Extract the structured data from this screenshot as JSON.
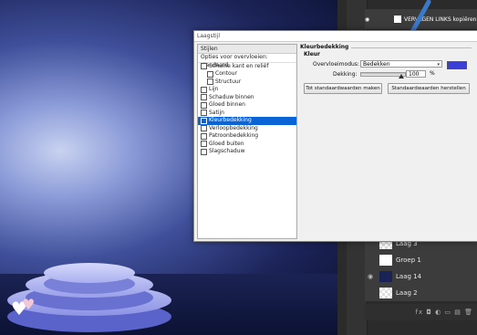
{
  "dialog": {
    "title": "Laagstijl",
    "styles_header": "Stijlen",
    "blend_options": "Opties voor overvloeien: standaard",
    "items": [
      {
        "label": "Schuine kant en reliëf",
        "indent": false,
        "active": false
      },
      {
        "label": "Contour",
        "indent": true,
        "active": false
      },
      {
        "label": "Structuur",
        "indent": true,
        "active": false
      },
      {
        "label": "Lijn",
        "indent": false,
        "active": false
      },
      {
        "label": "Schaduw binnen",
        "indent": false,
        "active": false
      },
      {
        "label": "Gloed binnen",
        "indent": false,
        "active": false
      },
      {
        "label": "Satijn",
        "indent": false,
        "active": false
      },
      {
        "label": "Kleurbedekking",
        "indent": false,
        "active": true
      },
      {
        "label": "Verloopbedekking",
        "indent": false,
        "active": false
      },
      {
        "label": "Patroonbedekking",
        "indent": false,
        "active": false
      },
      {
        "label": "Gloed buiten",
        "indent": false,
        "active": false
      },
      {
        "label": "Slagschaduw",
        "indent": false,
        "active": false
      }
    ],
    "section_title": "Kleurbedekking",
    "section_sub": "Kleur",
    "blend_mode_label": "Overvloeimodus:",
    "blend_mode_value": "Bedekken",
    "opacity_label": "Dekking:",
    "opacity_value": "100",
    "opacity_unit": "%",
    "color_swatch": "#3b3fd6",
    "btn_default": "Tot standaardwaarden maken",
    "btn_reset": "Standaardwaarden herstellen"
  },
  "layers": {
    "top_layer": "VERVAGEN LINKS kopiëren",
    "rows": [
      {
        "name": "Laag 3",
        "thumb": "checker",
        "eye": ""
      },
      {
        "name": "Groep 1",
        "thumb": "white",
        "eye": ""
      },
      {
        "name": "Laag 14",
        "thumb": "dark",
        "eye": "◉"
      },
      {
        "name": "Laag 2",
        "thumb": "checker",
        "eye": ""
      }
    ],
    "bottom_icons": "fx ◘ ◐ ▭ ▤ 🗑"
  },
  "colors": {
    "accent": "#0a64d6",
    "overlay_color": "#3b3fd6",
    "arrow": "#3a78c8"
  }
}
